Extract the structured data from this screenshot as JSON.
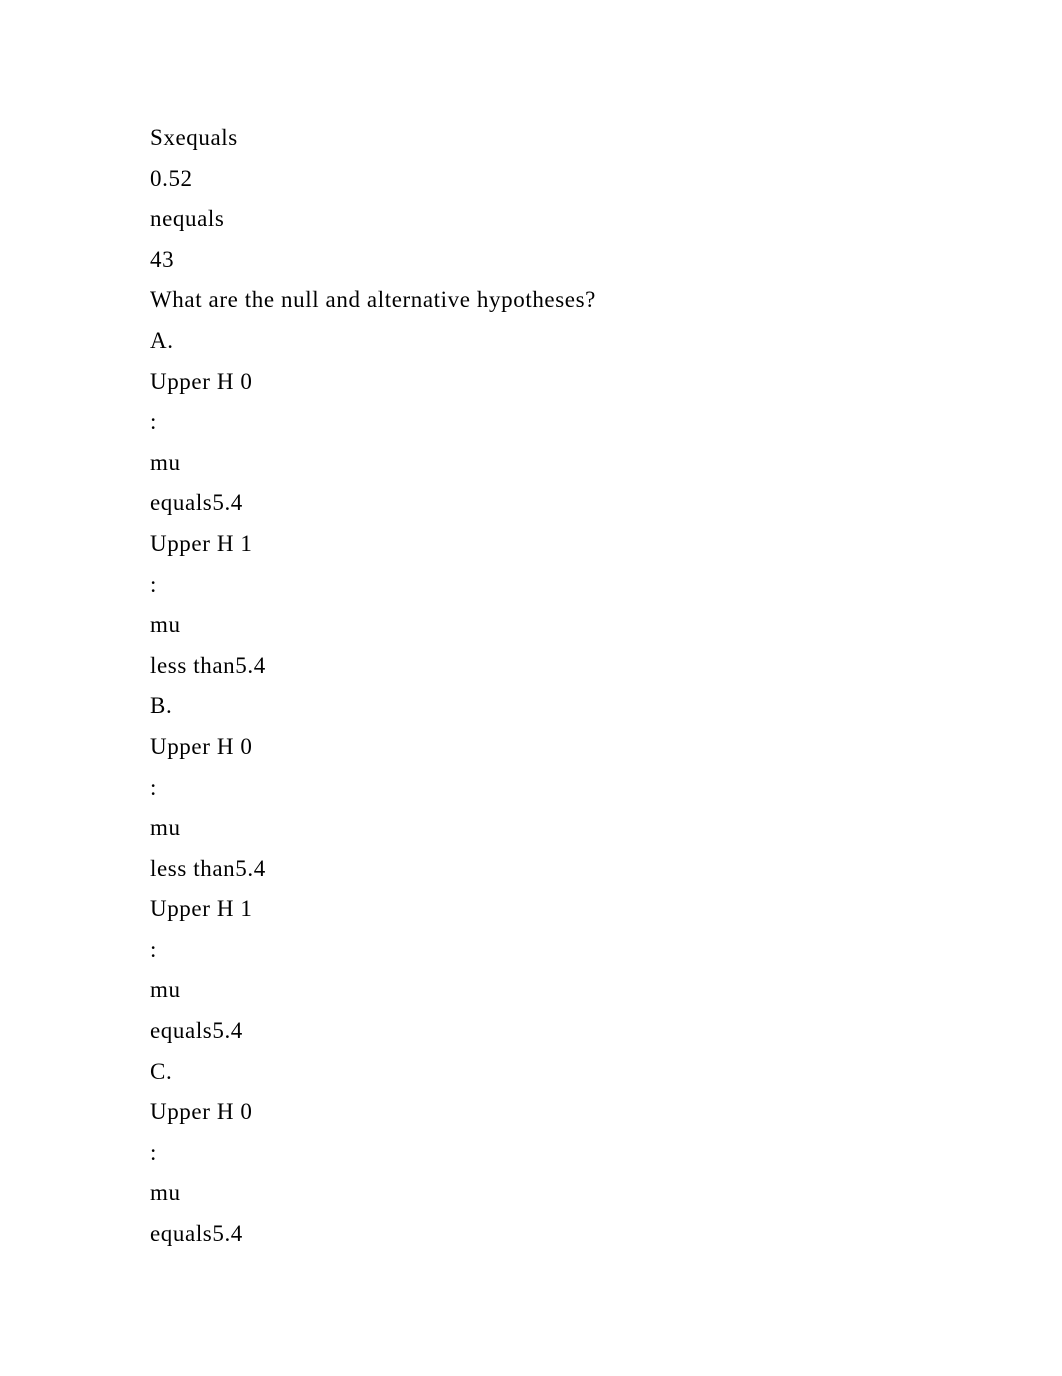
{
  "lines": [
    "Sxequals",
    "0.52",
    "nequals",
    "43",
    "What are the null and alternative hypotheses?",
    "A.",
    "Upper H 0",
    ":",
    "mu",
    "equals5.4",
    "Upper H 1",
    ":",
    "mu",
    "less than5.4",
    "B.",
    "Upper H 0",
    ":",
    "mu",
    "less than5.4",
    "Upper H 1",
    ":",
    "mu",
    "equals5.4",
    "C.",
    "Upper H 0",
    ":",
    "mu",
    "equals5.4"
  ]
}
